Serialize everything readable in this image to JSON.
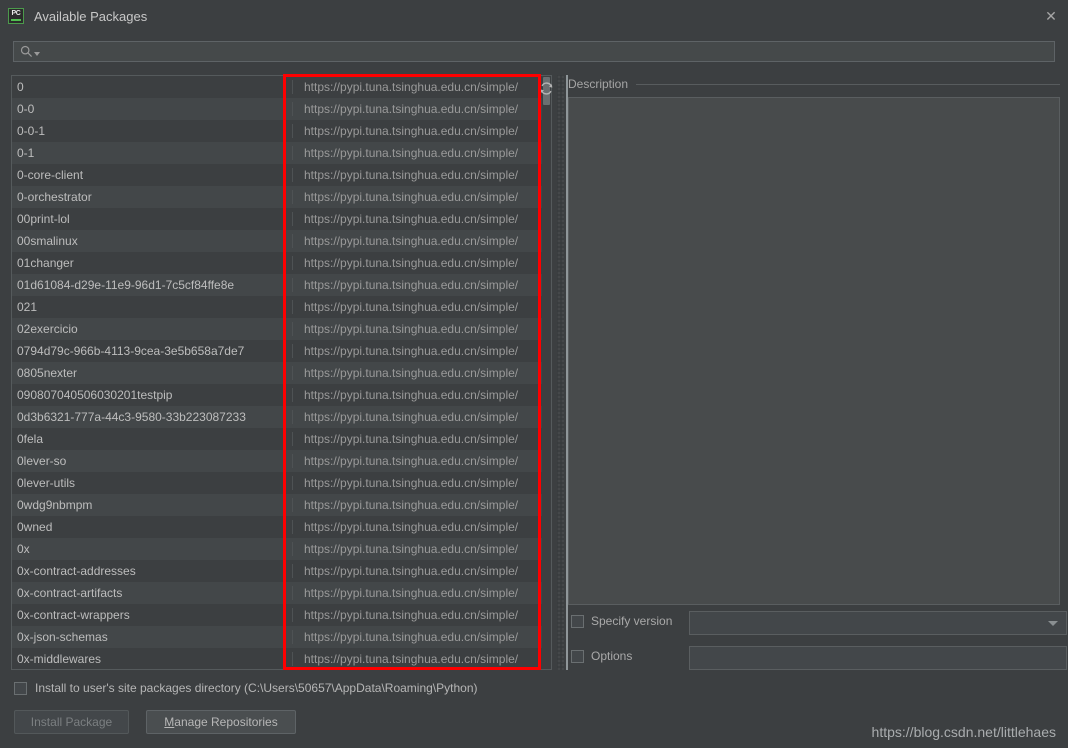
{
  "window": {
    "title": "Available Packages",
    "app_icon": "pycharm-icon",
    "app_icon_text": "PC",
    "close_icon": "✕"
  },
  "search": {
    "value": "",
    "placeholder": "",
    "icon": "search-icon",
    "dropdown_icon": "caret-down-icon"
  },
  "packages": {
    "repository_url": "https://pypi.tuna.tsinghua.edu.cn/simple/",
    "refresh_icon": "↻",
    "names": [
      "0",
      "0-0",
      "0-0-1",
      "0-1",
      "0-core-client",
      "0-orchestrator",
      "00print-lol",
      "00smalinux",
      "01changer",
      "01d61084-d29e-11e9-96d1-7c5cf84ffe8e",
      "021",
      "02exercicio",
      "0794d79c-966b-4113-9cea-3e5b658a7de7",
      "0805nexter",
      "090807040506030201testpip",
      "0d3b6321-777a-44c3-9580-33b223087233",
      "0fela",
      "0lever-so",
      "0lever-utils",
      "0wdg9nbmpm",
      "0wned",
      "0x",
      "0x-contract-addresses",
      "0x-contract-artifacts",
      "0x-contract-wrappers",
      "0x-json-schemas",
      "0x-middlewares"
    ]
  },
  "description": {
    "title": "Description",
    "body": ""
  },
  "version": {
    "checkbox_label": "Specify version",
    "checked": false,
    "selected_value": "",
    "dropdown_icon": "chevron-down-icon"
  },
  "options": {
    "checkbox_label": "Options",
    "checked": false,
    "value": ""
  },
  "install_user_site": {
    "label": "Install to user's site packages directory (C:\\Users\\50657\\AppData\\Roaming\\Python)",
    "checked": false
  },
  "buttons": {
    "install_package": "Install Package",
    "manage_repositories_mnemonic": "M",
    "manage_repositories_rest": "anage Repositories"
  },
  "watermark": "https://blog.csdn.net/littlehaes",
  "colors": {
    "window_bg": "#3c3f41",
    "row_alt_bg": "#434749",
    "annotation": "#fe0000",
    "accent_green": "#4fbf4f"
  }
}
